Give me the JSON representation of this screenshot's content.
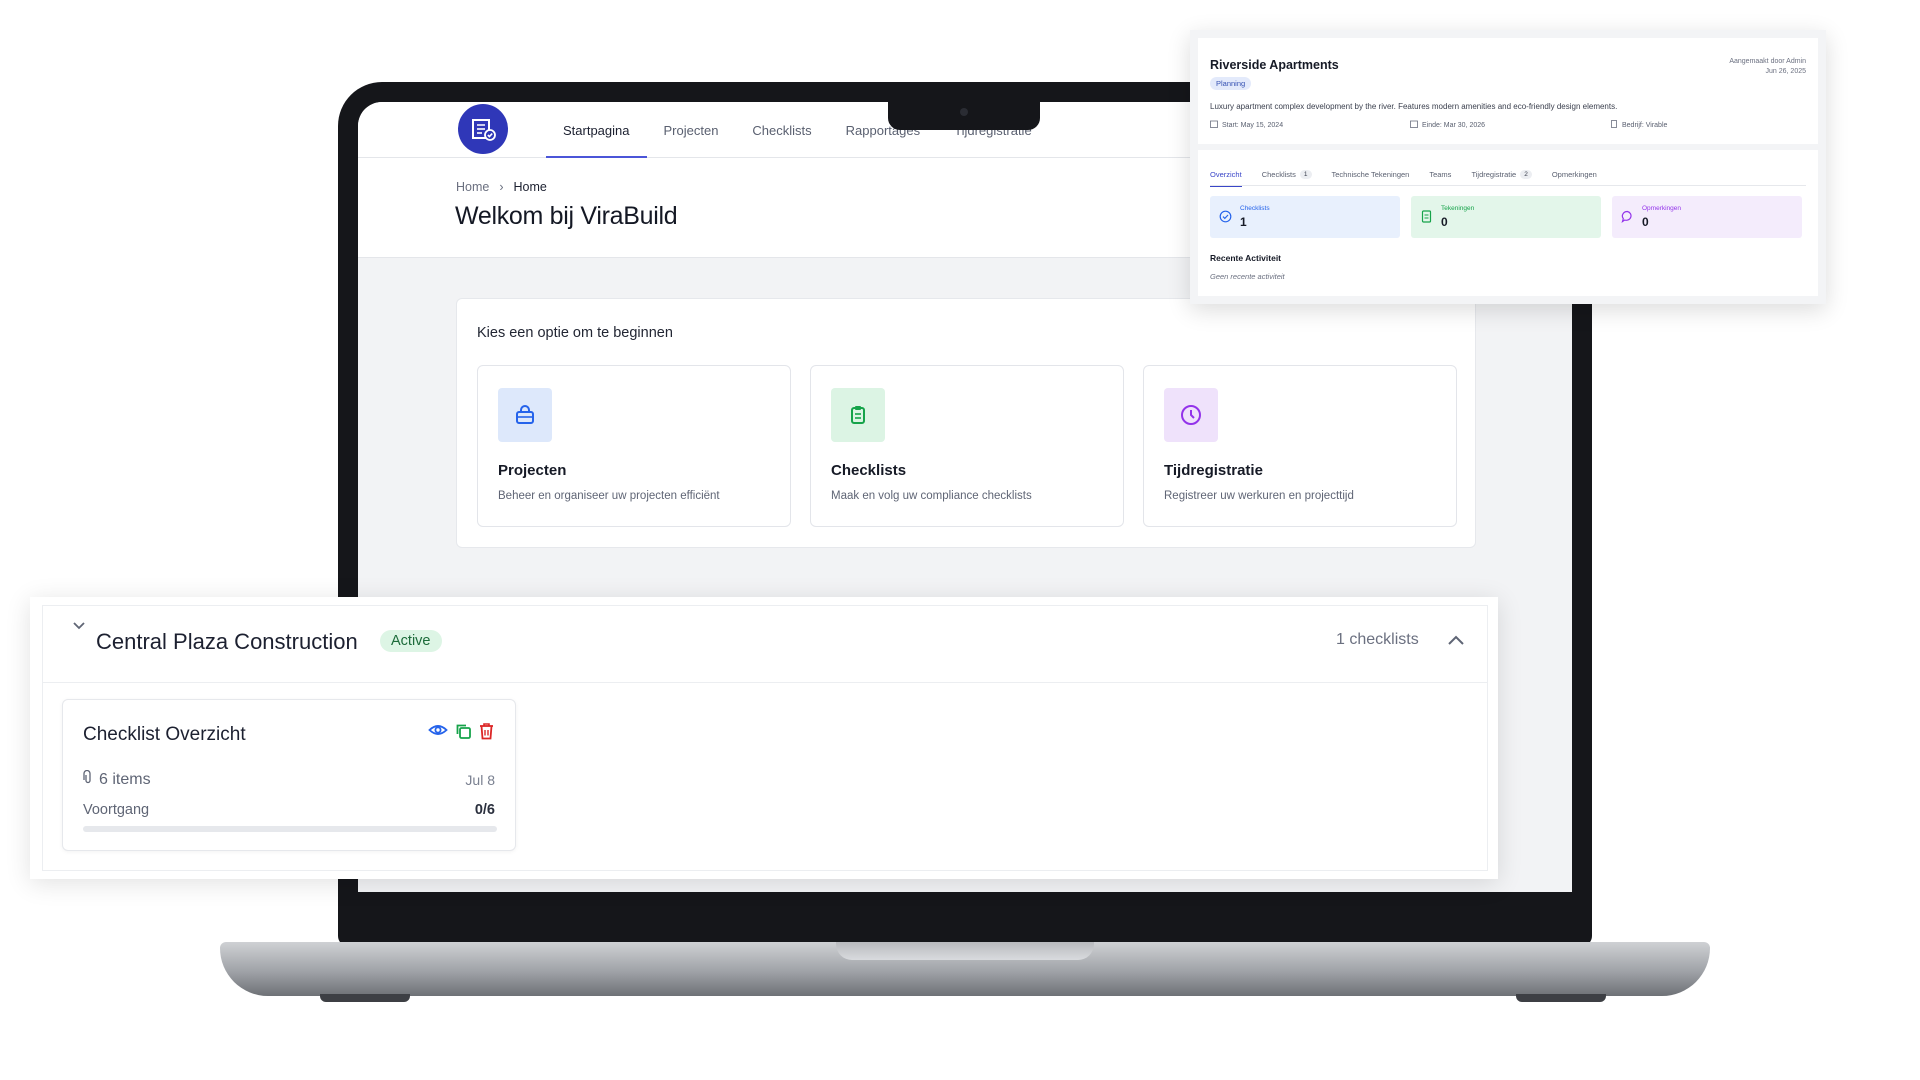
{
  "app": {
    "nav": [
      "Startpagina",
      "Projecten",
      "Checklists",
      "Rapportages",
      "Tijdregistratie"
    ],
    "breadcrumb": {
      "root": "Home",
      "current": "Home"
    },
    "title": "Welkom bij ViraBuild",
    "panel_title": "Kies een optie om te beginnen",
    "cards": [
      {
        "title": "Projecten",
        "desc": "Beheer en organiseer uw projecten efficiënt",
        "icon": "briefcase-icon",
        "tint": "#dde8fb",
        "color": "#2563eb"
      },
      {
        "title": "Checklists",
        "desc": "Maak en volg uw compliance checklists",
        "icon": "clipboard-icon",
        "tint": "#dcf4e4",
        "color": "#16a34a"
      },
      {
        "title": "Tijdregistratie",
        "desc": "Registreer uw werkuren en projecttijd",
        "icon": "clock-icon",
        "tint": "#efe2fb",
        "color": "#9333ea"
      }
    ]
  },
  "project_card": {
    "name": "Riverside Apartments",
    "status": "Planning",
    "created_by": "Aangemaakt door Admin",
    "created_date": "Jun 26, 2025",
    "description": "Luxury apartment complex development by the river. Features modern amenities and eco-friendly design elements.",
    "start": "Start: May 15, 2024",
    "end": "Einde: Mar 30, 2026",
    "company": "Bedrijf: Virable",
    "tabs": [
      {
        "label": "Overzicht",
        "count": ""
      },
      {
        "label": "Checklists",
        "count": "1"
      },
      {
        "label": "Technische Tekeningen",
        "count": ""
      },
      {
        "label": "Teams",
        "count": ""
      },
      {
        "label": "Tijdregistratie",
        "count": "2"
      },
      {
        "label": "Opmerkingen",
        "count": ""
      }
    ],
    "stats": [
      {
        "label": "Checklists",
        "value": "1",
        "bg": "#e8f0fd",
        "color": "#2563eb"
      },
      {
        "label": "Tekeningen",
        "value": "0",
        "bg": "#e3f6ea",
        "color": "#16a34a"
      },
      {
        "label": "Opmerkingen",
        "value": "0",
        "bg": "#f4ecfc",
        "color": "#9333ea"
      }
    ],
    "recent_title": "Recente Activiteit",
    "recent_empty": "Geen recente activiteit"
  },
  "checklist_group": {
    "project": "Central Plaza Construction",
    "status": "Active",
    "count": "1 checklists",
    "item": {
      "title": "Checklist Overzicht",
      "items_count": "6 items",
      "date": "Jul 8",
      "progress_label": "Voortgang",
      "progress_value": "0/6",
      "progress_fraction": 0
    }
  },
  "colors": {
    "accent": "#4b55d8",
    "logo_bg": "#2f37b8",
    "active_green": "#ddf5e5"
  }
}
